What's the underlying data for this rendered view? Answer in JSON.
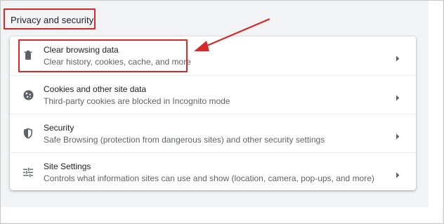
{
  "section": {
    "title": "Privacy and security"
  },
  "rows": [
    {
      "title": "Clear browsing data",
      "subtitle": "Clear history, cookies, cache, and more",
      "icon": "trash-icon"
    },
    {
      "title": "Cookies and other site data",
      "subtitle": "Third-party cookies are blocked in Incognito mode",
      "icon": "cookie-icon"
    },
    {
      "title": "Security",
      "subtitle": "Safe Browsing (protection from dangerous sites) and other security settings",
      "icon": "shield-icon"
    },
    {
      "title": "Site Settings",
      "subtitle": "Controls what information sites can use and show (location, camera, pop-ups, and more)",
      "icon": "sliders-icon"
    }
  ],
  "annotations": {
    "highlight_color": "#d62a2a"
  },
  "colors": {
    "text_primary": "#202124",
    "text_secondary": "#5f6368",
    "background": "#f1f3f4"
  }
}
